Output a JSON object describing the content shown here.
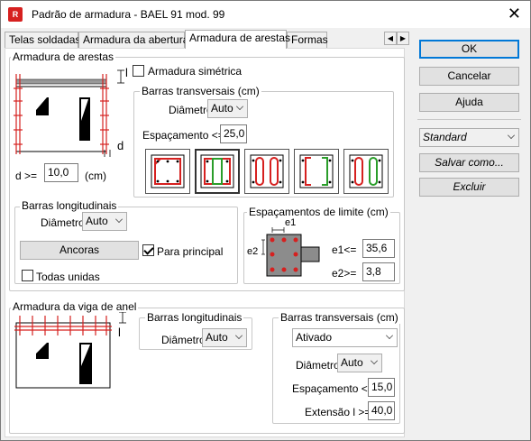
{
  "window": {
    "title": "Padrão de armadura - BAEL 91 mod. 99",
    "icon_text": "R"
  },
  "tabs": [
    "Telas soldadas",
    "Armadura da abertura",
    "Armadura de arestas",
    "Formas"
  ],
  "active_tab": "Armadura de arestas",
  "edges": {
    "group_label": "Armadura de arestas",
    "symmetric_label": "Armadura simétrica",
    "symmetric_checked": false,
    "l_mark": "l",
    "d_mark": "d",
    "d_label": "d >=",
    "d_value": "10,0",
    "d_unit": "(cm)"
  },
  "transverse": {
    "group_label": "Barras transversais (cm)",
    "diameter_label": "Diâmetro",
    "diameter_value": "Auto",
    "spacing_label": "Espaçamento <=",
    "spacing_value": "25,0",
    "selected_pattern": 1
  },
  "longitudinal": {
    "group_label": "Barras longitudinais",
    "diameter_label": "Diâmetro",
    "diameter_value": "Auto",
    "anchors_label": "Ancoras",
    "main_label": "Para principal",
    "main_checked": true,
    "all_label": "Todas unidas",
    "all_checked": false
  },
  "limits": {
    "group_label": "Espaçamentos de limite (cm)",
    "e1_mark": "e1",
    "e2_mark": "e2",
    "e1_label": "e1<=",
    "e1_value": "35,6",
    "e2_label": "e2>=",
    "e2_value": "3,8"
  },
  "ring_beam": {
    "group_label": "Armadura da viga de anel",
    "l_mark": "l",
    "long_group": "Barras longitudinais",
    "long_diameter_label": "Diâmetro",
    "long_diameter_value": "Auto",
    "trans_group": "Barras transversais (cm)",
    "trans_mode": "Ativado",
    "trans_diameter_label": "Diâmetro",
    "trans_diameter_value": "Auto",
    "trans_spacing_label": "Espaçamento <=",
    "trans_spacing_value": "15,0",
    "extension_label": "Extensão l >=",
    "extension_value": "40,0"
  },
  "sidebar": {
    "ok": "OK",
    "cancel": "Cancelar",
    "help": "Ajuda",
    "standard": "Standard",
    "save_as": "Salvar como...",
    "delete": "Excluir"
  },
  "colors": {
    "rebar": "#d6201f",
    "stirrup_alt": "#2a9d2a",
    "concrete": "#808080"
  }
}
